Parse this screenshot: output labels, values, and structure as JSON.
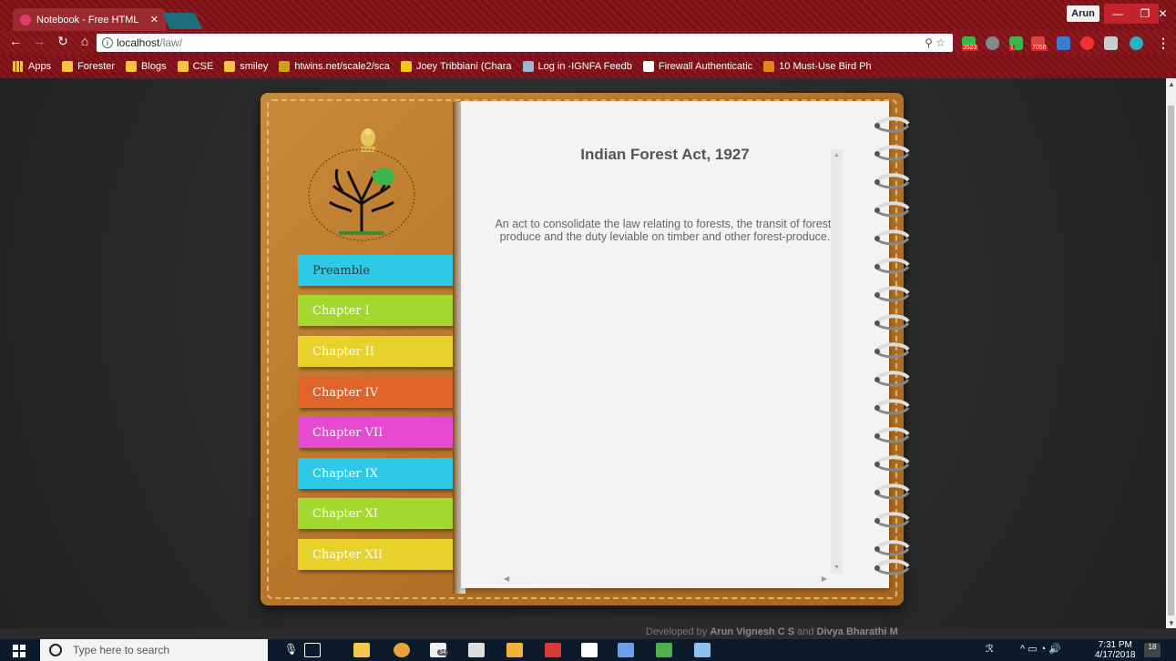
{
  "browser": {
    "tab_title": "Notebook - Free HTML",
    "user_name": "Arun",
    "url_host": "localhost",
    "url_path": "/law/",
    "extension_badges": [
      "3523",
      "1",
      "7056"
    ],
    "bookmarks": [
      {
        "label": "Apps",
        "icon": "apps-grid-icon"
      },
      {
        "label": "Forester",
        "icon": "folder-icon"
      },
      {
        "label": "Blogs",
        "icon": "folder-icon"
      },
      {
        "label": "CSE",
        "icon": "folder-icon"
      },
      {
        "label": "smiley",
        "icon": "folder-icon"
      },
      {
        "label": "htwins.net/scale2/sca",
        "icon": "site-icon"
      },
      {
        "label": "Joey Tribbiani (Chara",
        "icon": "imdb-icon"
      },
      {
        "label": "Log in -IGNFA Feedb",
        "icon": "page-icon"
      },
      {
        "label": "Firewall Authenticatic",
        "icon": "page-icon"
      },
      {
        "label": "10 Must-Use Bird Ph",
        "icon": "site-icon"
      }
    ]
  },
  "notebook": {
    "chapters": [
      {
        "label": "Preamble",
        "color": "#2ec9e6"
      },
      {
        "label": "Chapter I",
        "color": "#a3d92f"
      },
      {
        "label": "Chapter II",
        "color": "#e9d12b"
      },
      {
        "label": "Chapter IV",
        "color": "#e0632a"
      },
      {
        "label": "Chapter VII",
        "color": "#e64ad0"
      },
      {
        "label": "Chapter IX",
        "color": "#2ec9e6"
      },
      {
        "label": "Chapter XI",
        "color": "#a3d92f"
      },
      {
        "label": "Chapter XII",
        "color": "#e9d12b"
      }
    ],
    "title": "Indian Forest Act, 1927",
    "description": "An act to consolidate the law relating to forests, the transit of forest-produce and the duty leviable on timber and other forest-produce."
  },
  "footer": {
    "prefix": "Developed by",
    "author1": "Arun Vignesh C S",
    "joiner": "and",
    "author2": "Divya Bharathi M"
  },
  "taskbar": {
    "search_placeholder": "Type here to search",
    "time": "7:31 PM",
    "date": "4/17/2018",
    "notifications": "18",
    "pinned_badge": "34"
  }
}
